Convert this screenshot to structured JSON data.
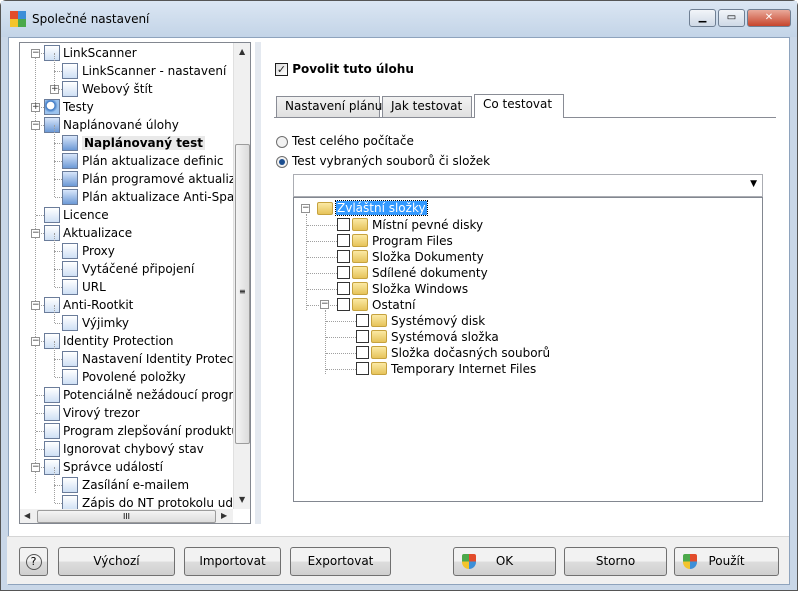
{
  "window": {
    "title": "Společné nastavení",
    "controls": [
      "minimize",
      "maximize",
      "close"
    ]
  },
  "sidebar": {
    "items": [
      {
        "label": "LinkScanner",
        "level": 0,
        "expander": "minus",
        "icon": "document-list-icon"
      },
      {
        "label": "LinkScanner - nastavení",
        "level": 1,
        "icon": "document-list-icon"
      },
      {
        "label": "Webový štít",
        "level": 1,
        "expander": "plus",
        "icon": "document-list-icon"
      },
      {
        "label": "Testy",
        "level": 0,
        "expander": "plus",
        "icon": "search-icon"
      },
      {
        "label": "Naplánované úlohy",
        "level": 0,
        "expander": "minus",
        "icon": "schedule-icon"
      },
      {
        "label": "Naplánovaný test",
        "level": 1,
        "icon": "schedule-icon",
        "selected": true
      },
      {
        "label": "Plán aktualizace definic",
        "level": 1,
        "icon": "schedule-icon"
      },
      {
        "label": "Plán programové aktualizace",
        "level": 1,
        "icon": "schedule-icon"
      },
      {
        "label": "Plán aktualizace Anti-Spamu",
        "level": 1,
        "icon": "schedule-icon"
      },
      {
        "label": "Licence",
        "level": 0,
        "icon": "document-list-icon"
      },
      {
        "label": "Aktualizace",
        "level": 0,
        "expander": "minus",
        "icon": "document-list-icon"
      },
      {
        "label": "Proxy",
        "level": 1,
        "icon": "document-list-icon"
      },
      {
        "label": "Vytáčené připojení",
        "level": 1,
        "icon": "document-list-icon"
      },
      {
        "label": "URL",
        "level": 1,
        "icon": "document-list-icon"
      },
      {
        "label": "Anti-Rootkit",
        "level": 0,
        "expander": "minus",
        "icon": "document-list-icon"
      },
      {
        "label": "Výjimky",
        "level": 1,
        "icon": "document-list-icon"
      },
      {
        "label": "Identity Protection",
        "level": 0,
        "expander": "minus",
        "icon": "document-list-icon"
      },
      {
        "label": "Nastavení Identity Protection",
        "level": 1,
        "icon": "document-list-icon"
      },
      {
        "label": "Povolené položky",
        "level": 1,
        "icon": "document-list-icon"
      },
      {
        "label": "Potenciálně nežádoucí programy",
        "level": 0,
        "icon": "document-list-icon"
      },
      {
        "label": "Virový trezor",
        "level": 0,
        "icon": "document-list-icon"
      },
      {
        "label": "Program zlepšování produktu",
        "level": 0,
        "icon": "document-list-icon"
      },
      {
        "label": "Ignorovat chybový stav",
        "level": 0,
        "icon": "document-list-icon"
      },
      {
        "label": "Správce událostí",
        "level": 0,
        "expander": "minus",
        "icon": "document-list-icon"
      },
      {
        "label": "Zasílání e-mailem",
        "level": 1,
        "icon": "document-list-icon"
      },
      {
        "label": "Zápis do NT protokolu událostí",
        "level": 1,
        "icon": "document-list-icon"
      }
    ]
  },
  "main": {
    "enable_task": {
      "label": "Povolit tuto úlohu",
      "checked": true
    },
    "tabs": [
      {
        "label": "Nastavení plánu",
        "active": false
      },
      {
        "label": "Jak testovat",
        "active": false
      },
      {
        "label": "Co testovat",
        "active": true
      }
    ],
    "scan_options": [
      {
        "label": "Test celého počítače",
        "selected": false
      },
      {
        "label": "Test vybraných souborů či složek",
        "selected": true
      }
    ],
    "path_combo": {
      "value": ""
    },
    "folder_tree": {
      "root": {
        "label": "Zvláštní složky",
        "icon": "special-folder-icon"
      },
      "items": [
        {
          "label": "Místní pevné disky",
          "level": 1,
          "icon": "hard-drive-icon",
          "checked": false
        },
        {
          "label": "Program Files",
          "level": 1,
          "icon": "folder-window-icon",
          "checked": false
        },
        {
          "label": "Složka Dokumenty",
          "level": 1,
          "icon": "documents-folder-icon",
          "checked": false
        },
        {
          "label": "Sdílené dokumenty",
          "level": 1,
          "icon": "shared-documents-icon",
          "checked": false
        },
        {
          "label": "Složka Windows",
          "level": 1,
          "icon": "windows-folder-icon",
          "checked": false
        },
        {
          "label": "Ostatní",
          "level": 1,
          "icon": "folder-icon",
          "checked": false,
          "expander": "minus"
        },
        {
          "label": "Systémový disk",
          "level": 2,
          "icon": "system-disk-icon",
          "checked": false
        },
        {
          "label": "Systémová složka",
          "level": 2,
          "icon": "system-folder-icon",
          "checked": false
        },
        {
          "label": "Složka dočasných souborů",
          "level": 2,
          "icon": "temp-folder-icon",
          "checked": false
        },
        {
          "label": "Temporary Internet Files",
          "level": 2,
          "icon": "internet-folder-icon",
          "checked": false
        }
      ]
    }
  },
  "footer": {
    "help": "?",
    "default": "Výchozí",
    "import": "Importovat",
    "export": "Exportovat",
    "ok": "OK",
    "cancel": "Storno",
    "apply": "Použít"
  }
}
